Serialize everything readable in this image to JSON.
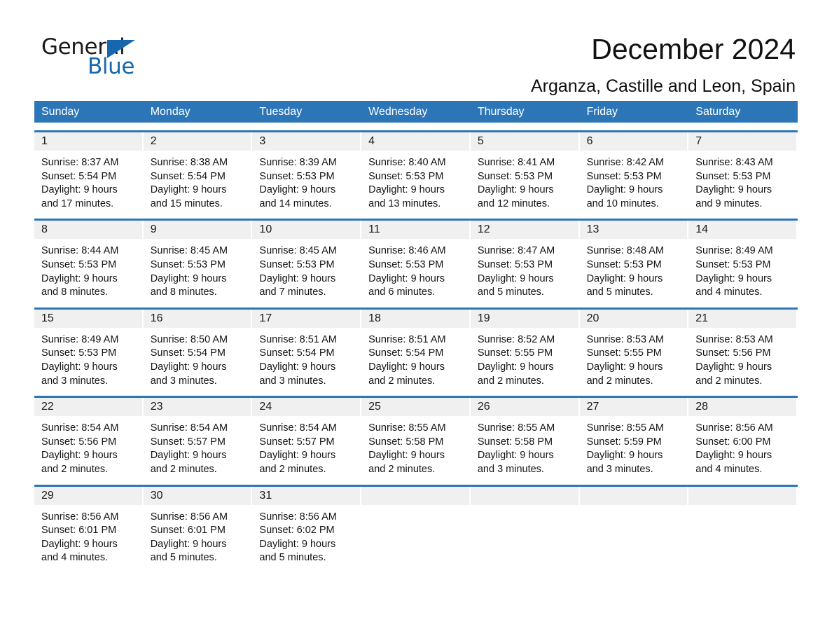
{
  "logo": {
    "word1": "General",
    "word2": "Blue",
    "accent_color": "#1667ad",
    "triangle": "triangle-icon"
  },
  "header": {
    "title": "December 2024",
    "location": "Arganza, Castille and Leon, Spain"
  },
  "calendar": {
    "header_bg": "#2c76b8",
    "daterow_bg": "#f0f0f0",
    "weekdays": [
      "Sunday",
      "Monday",
      "Tuesday",
      "Wednesday",
      "Thursday",
      "Friday",
      "Saturday"
    ],
    "weeks": [
      [
        {
          "day": "1",
          "sunrise": "Sunrise: 8:37 AM",
          "sunset": "Sunset: 5:54 PM",
          "daylight1": "Daylight: 9 hours",
          "daylight2": "and 17 minutes."
        },
        {
          "day": "2",
          "sunrise": "Sunrise: 8:38 AM",
          "sunset": "Sunset: 5:54 PM",
          "daylight1": "Daylight: 9 hours",
          "daylight2": "and 15 minutes."
        },
        {
          "day": "3",
          "sunrise": "Sunrise: 8:39 AM",
          "sunset": "Sunset: 5:53 PM",
          "daylight1": "Daylight: 9 hours",
          "daylight2": "and 14 minutes."
        },
        {
          "day": "4",
          "sunrise": "Sunrise: 8:40 AM",
          "sunset": "Sunset: 5:53 PM",
          "daylight1": "Daylight: 9 hours",
          "daylight2": "and 13 minutes."
        },
        {
          "day": "5",
          "sunrise": "Sunrise: 8:41 AM",
          "sunset": "Sunset: 5:53 PM",
          "daylight1": "Daylight: 9 hours",
          "daylight2": "and 12 minutes."
        },
        {
          "day": "6",
          "sunrise": "Sunrise: 8:42 AM",
          "sunset": "Sunset: 5:53 PM",
          "daylight1": "Daylight: 9 hours",
          "daylight2": "and 10 minutes."
        },
        {
          "day": "7",
          "sunrise": "Sunrise: 8:43 AM",
          "sunset": "Sunset: 5:53 PM",
          "daylight1": "Daylight: 9 hours",
          "daylight2": "and 9 minutes."
        }
      ],
      [
        {
          "day": "8",
          "sunrise": "Sunrise: 8:44 AM",
          "sunset": "Sunset: 5:53 PM",
          "daylight1": "Daylight: 9 hours",
          "daylight2": "and 8 minutes."
        },
        {
          "day": "9",
          "sunrise": "Sunrise: 8:45 AM",
          "sunset": "Sunset: 5:53 PM",
          "daylight1": "Daylight: 9 hours",
          "daylight2": "and 8 minutes."
        },
        {
          "day": "10",
          "sunrise": "Sunrise: 8:45 AM",
          "sunset": "Sunset: 5:53 PM",
          "daylight1": "Daylight: 9 hours",
          "daylight2": "and 7 minutes."
        },
        {
          "day": "11",
          "sunrise": "Sunrise: 8:46 AM",
          "sunset": "Sunset: 5:53 PM",
          "daylight1": "Daylight: 9 hours",
          "daylight2": "and 6 minutes."
        },
        {
          "day": "12",
          "sunrise": "Sunrise: 8:47 AM",
          "sunset": "Sunset: 5:53 PM",
          "daylight1": "Daylight: 9 hours",
          "daylight2": "and 5 minutes."
        },
        {
          "day": "13",
          "sunrise": "Sunrise: 8:48 AM",
          "sunset": "Sunset: 5:53 PM",
          "daylight1": "Daylight: 9 hours",
          "daylight2": "and 5 minutes."
        },
        {
          "day": "14",
          "sunrise": "Sunrise: 8:49 AM",
          "sunset": "Sunset: 5:53 PM",
          "daylight1": "Daylight: 9 hours",
          "daylight2": "and 4 minutes."
        }
      ],
      [
        {
          "day": "15",
          "sunrise": "Sunrise: 8:49 AM",
          "sunset": "Sunset: 5:53 PM",
          "daylight1": "Daylight: 9 hours",
          "daylight2": "and 3 minutes."
        },
        {
          "day": "16",
          "sunrise": "Sunrise: 8:50 AM",
          "sunset": "Sunset: 5:54 PM",
          "daylight1": "Daylight: 9 hours",
          "daylight2": "and 3 minutes."
        },
        {
          "day": "17",
          "sunrise": "Sunrise: 8:51 AM",
          "sunset": "Sunset: 5:54 PM",
          "daylight1": "Daylight: 9 hours",
          "daylight2": "and 3 minutes."
        },
        {
          "day": "18",
          "sunrise": "Sunrise: 8:51 AM",
          "sunset": "Sunset: 5:54 PM",
          "daylight1": "Daylight: 9 hours",
          "daylight2": "and 2 minutes."
        },
        {
          "day": "19",
          "sunrise": "Sunrise: 8:52 AM",
          "sunset": "Sunset: 5:55 PM",
          "daylight1": "Daylight: 9 hours",
          "daylight2": "and 2 minutes."
        },
        {
          "day": "20",
          "sunrise": "Sunrise: 8:53 AM",
          "sunset": "Sunset: 5:55 PM",
          "daylight1": "Daylight: 9 hours",
          "daylight2": "and 2 minutes."
        },
        {
          "day": "21",
          "sunrise": "Sunrise: 8:53 AM",
          "sunset": "Sunset: 5:56 PM",
          "daylight1": "Daylight: 9 hours",
          "daylight2": "and 2 minutes."
        }
      ],
      [
        {
          "day": "22",
          "sunrise": "Sunrise: 8:54 AM",
          "sunset": "Sunset: 5:56 PM",
          "daylight1": "Daylight: 9 hours",
          "daylight2": "and 2 minutes."
        },
        {
          "day": "23",
          "sunrise": "Sunrise: 8:54 AM",
          "sunset": "Sunset: 5:57 PM",
          "daylight1": "Daylight: 9 hours",
          "daylight2": "and 2 minutes."
        },
        {
          "day": "24",
          "sunrise": "Sunrise: 8:54 AM",
          "sunset": "Sunset: 5:57 PM",
          "daylight1": "Daylight: 9 hours",
          "daylight2": "and 2 minutes."
        },
        {
          "day": "25",
          "sunrise": "Sunrise: 8:55 AM",
          "sunset": "Sunset: 5:58 PM",
          "daylight1": "Daylight: 9 hours",
          "daylight2": "and 2 minutes."
        },
        {
          "day": "26",
          "sunrise": "Sunrise: 8:55 AM",
          "sunset": "Sunset: 5:58 PM",
          "daylight1": "Daylight: 9 hours",
          "daylight2": "and 3 minutes."
        },
        {
          "day": "27",
          "sunrise": "Sunrise: 8:55 AM",
          "sunset": "Sunset: 5:59 PM",
          "daylight1": "Daylight: 9 hours",
          "daylight2": "and 3 minutes."
        },
        {
          "day": "28",
          "sunrise": "Sunrise: 8:56 AM",
          "sunset": "Sunset: 6:00 PM",
          "daylight1": "Daylight: 9 hours",
          "daylight2": "and 4 minutes."
        }
      ],
      [
        {
          "day": "29",
          "sunrise": "Sunrise: 8:56 AM",
          "sunset": "Sunset: 6:01 PM",
          "daylight1": "Daylight: 9 hours",
          "daylight2": "and 4 minutes."
        },
        {
          "day": "30",
          "sunrise": "Sunrise: 8:56 AM",
          "sunset": "Sunset: 6:01 PM",
          "daylight1": "Daylight: 9 hours",
          "daylight2": "and 5 minutes."
        },
        {
          "day": "31",
          "sunrise": "Sunrise: 8:56 AM",
          "sunset": "Sunset: 6:02 PM",
          "daylight1": "Daylight: 9 hours",
          "daylight2": "and 5 minutes."
        },
        {
          "day": "",
          "sunrise": "",
          "sunset": "",
          "daylight1": "",
          "daylight2": ""
        },
        {
          "day": "",
          "sunrise": "",
          "sunset": "",
          "daylight1": "",
          "daylight2": ""
        },
        {
          "day": "",
          "sunrise": "",
          "sunset": "",
          "daylight1": "",
          "daylight2": ""
        },
        {
          "day": "",
          "sunrise": "",
          "sunset": "",
          "daylight1": "",
          "daylight2": ""
        }
      ]
    ]
  }
}
